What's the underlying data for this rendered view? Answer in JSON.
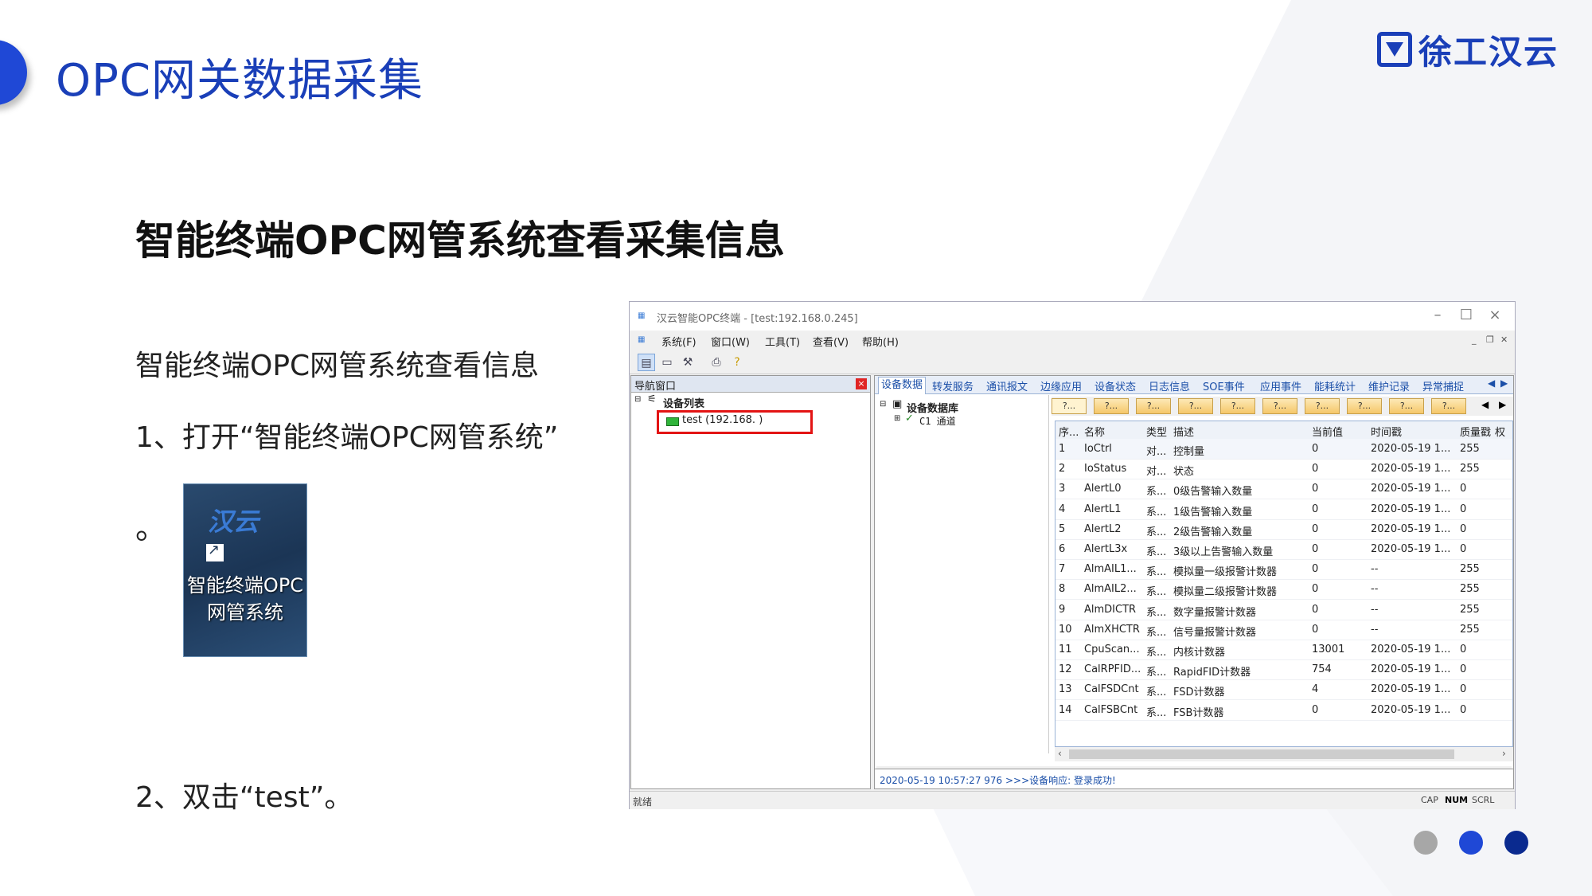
{
  "slide": {
    "title": "OPC网关数据采集",
    "logo_text": "徐工汉云",
    "subtitle": "智能终端OPC网管系统查看采集信息",
    "lines": [
      "智能终端OPC网管系统查看信息",
      "1、打开“智能终端OPC网管系统”",
      "。",
      "2、双击“test”。"
    ],
    "desktop_icon": {
      "logo": "汉云",
      "label": "智能终端OPC网管系统"
    },
    "pagination_colors": [
      "#a7a7a7",
      "#1f48d6",
      "#0a2a8f"
    ]
  },
  "app": {
    "title": "汉云智能OPC终端 - [test:192.168.0.245]",
    "menu": [
      "系统(F)",
      "窗口(W)",
      "工具(T)",
      "查看(V)",
      "帮助(H)"
    ],
    "nav": {
      "title": "导航窗口",
      "root": "设备列表",
      "device": "test (192.168.      )"
    },
    "tabs": [
      "设备数据",
      "转发服务",
      "通讯报文",
      "边缘应用",
      "设备状态",
      "日志信息",
      "SOE事件",
      "应用事件",
      "能耗统计",
      "维护记录",
      "异常捕捉"
    ],
    "db_tree": {
      "root": "设备数据库",
      "child": "C1 通道"
    },
    "sub_tab_label": "?...",
    "columns": [
      "序...",
      "名称",
      "类型",
      "描述",
      "当前值",
      "时间戳",
      "质量戳",
      "权限"
    ],
    "rows": [
      [
        "1",
        "IoCtrl",
        "对...",
        "控制量",
        "0",
        "2020-05-19 1...",
        "255"
      ],
      [
        "2",
        "IoStatus",
        "对...",
        "状态",
        "0",
        "2020-05-19 1...",
        "255"
      ],
      [
        "3",
        "AlertL0",
        "系...",
        "0级告警输入数量",
        "0",
        "2020-05-19 1...",
        "0"
      ],
      [
        "4",
        "AlertL1",
        "系...",
        "1级告警输入数量",
        "0",
        "2020-05-19 1...",
        "0"
      ],
      [
        "5",
        "AlertL2",
        "系...",
        "2级告警输入数量",
        "0",
        "2020-05-19 1...",
        "0"
      ],
      [
        "6",
        "AlertL3x",
        "系...",
        "3级以上告警输入数量",
        "0",
        "2020-05-19 1...",
        "0"
      ],
      [
        "7",
        "AlmAIL1...",
        "系...",
        "模拟量一级报警计数器",
        "0",
        "--",
        "255"
      ],
      [
        "8",
        "AlmAIL2...",
        "系...",
        "模拟量二级报警计数器",
        "0",
        "--",
        "255"
      ],
      [
        "9",
        "AlmDICTR",
        "系...",
        "数字量报警计数器",
        "0",
        "--",
        "255"
      ],
      [
        "10",
        "AlmXHCTR",
        "系...",
        "信号量报警计数器",
        "0",
        "--",
        "255"
      ],
      [
        "11",
        "CpuScan...",
        "系...",
        "内核计数器",
        "13001",
        "2020-05-19 1...",
        "0"
      ],
      [
        "12",
        "CalRPFID...",
        "系...",
        "RapidFID计数器",
        "754",
        "2020-05-19 1...",
        "0"
      ],
      [
        "13",
        "CalFSDCnt",
        "系...",
        "FSD计数器",
        "4",
        "2020-05-19 1...",
        "0"
      ],
      [
        "14",
        "CalFSBCnt",
        "系...",
        "FSB计数器",
        "0",
        "2020-05-19 1...",
        "0"
      ]
    ],
    "log": "2020-05-19 10:57:27 976 >>>设备响应: 登录成功!",
    "status": "就绪",
    "indicators": [
      "CAP",
      "NUM",
      "SCRL"
    ]
  }
}
